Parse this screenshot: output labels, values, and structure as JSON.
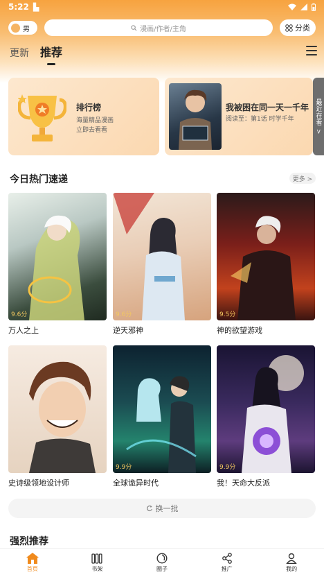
{
  "status_bar": {
    "time": "5:22",
    "sd_icon": "sd-card-icon",
    "icons": [
      "wifi-icon",
      "signal-icon",
      "battery-icon"
    ]
  },
  "header": {
    "gender_toggle": "男",
    "search_placeholder": "漫画/作者/主角",
    "category_label": "分类",
    "tabs": [
      {
        "label": "更新",
        "active": false
      },
      {
        "label": "推荐",
        "active": true
      }
    ]
  },
  "banners": {
    "ranking": {
      "title": "排行榜",
      "line1": "海量精品漫画",
      "line2": "立即去看看"
    },
    "recent": {
      "title": "我被困在同一天一千年",
      "progress": "阅读至：第1话 时学千年"
    },
    "side_tab": "最近在看 >"
  },
  "hot_section": {
    "title": "今日热门速递",
    "more_label": "更多 >",
    "comics": [
      {
        "title": "万人之上",
        "rating": "9.6分"
      },
      {
        "title": "逆天邪神",
        "rating": "9.6分"
      },
      {
        "title": "神的欲望游戏",
        "rating": "9.5分"
      },
      {
        "title": "史诗级领地设计师",
        "rating": ""
      },
      {
        "title": "全球诡异时代",
        "rating": "9.9分"
      },
      {
        "title": "我！天命大反派",
        "rating": "9.9分"
      }
    ],
    "refresh_label": "换一批"
  },
  "strong_section": {
    "title": "强烈推荐"
  },
  "bottom_nav": [
    {
      "label": "首页",
      "icon": "home-icon",
      "active": true
    },
    {
      "label": "书架",
      "icon": "bookshelf-icon",
      "active": false
    },
    {
      "label": "圈子",
      "icon": "circle-icon",
      "active": false
    },
    {
      "label": "推广",
      "icon": "share-icon",
      "active": false
    },
    {
      "label": "我的",
      "icon": "profile-icon",
      "active": false
    }
  ],
  "colors": {
    "accent": "#f08a1c",
    "header_top": "#f7a33f",
    "rating": "#f3c860"
  }
}
